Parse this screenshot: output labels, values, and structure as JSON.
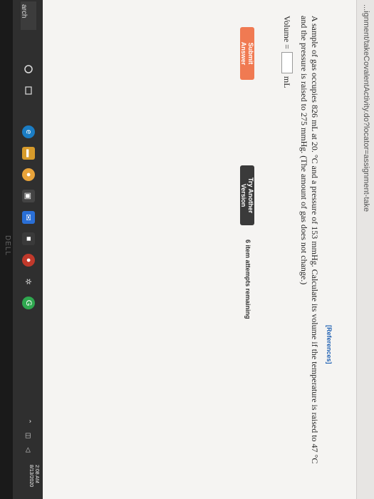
{
  "browser": {
    "url": "...ignment/takeCovalentActivity.do?locator=assignment-take"
  },
  "content": {
    "references_link": "[References]",
    "question": "A sample of gas occupies 826 mL at 20. °C and a pressure of 153 mmHg. Calculate its volume if the temperature is raised to 47 °C and the pressure is raised to 275 mmHg. (The amount of gas does not change.)",
    "answer_label": "Volume =",
    "answer_value": "",
    "answer_unit": "mL"
  },
  "actions": {
    "submit_label": "Submit Answer",
    "try_another_label": "Try Another Version",
    "attempts_text": "6 item attempts remaining"
  },
  "taskbar": {
    "search_label": "arch",
    "time": "2:08 AM",
    "date": "8/13/2020"
  },
  "brand": {
    "bezel_logo": "DELL"
  },
  "colors": {
    "submit_button": "#f07a52",
    "try_button": "#3a3a3a",
    "references": "#1d5fb3",
    "taskbar": "#2f2f2f"
  }
}
